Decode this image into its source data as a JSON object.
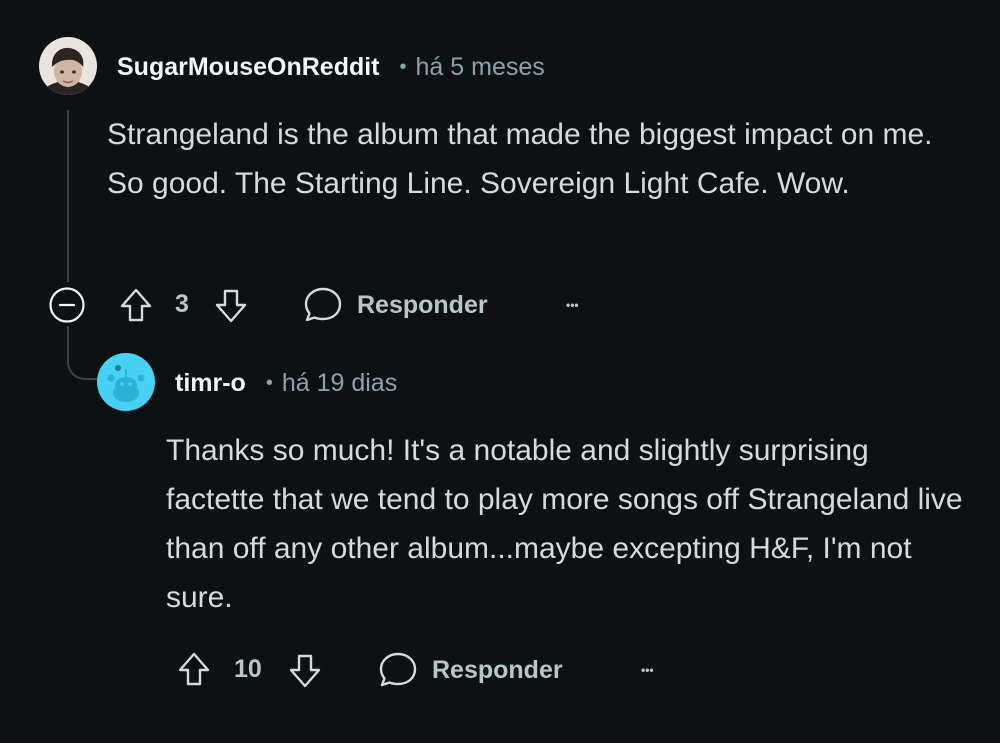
{
  "comments": [
    {
      "username": "SugarMouseOnReddit",
      "separator": "•",
      "timestamp": "há 5 meses",
      "text": "Strangeland is the album that made the biggest impact on me. So good. The Starting Line. Sovereign Light Cafe. Wow.",
      "votes": "3",
      "reply_label": "Responder",
      "more_label": "•••",
      "avatar_icon": "user-photo-avatar",
      "collapse_icon": "collapse-minus-icon"
    },
    {
      "username": "timr-o",
      "separator": "•",
      "timestamp": "há 19 dias",
      "text": "Thanks so much! It's a notable and slightly surprising factette that we tend to play more songs off Strangeland live than off any other album...maybe excepting H&F, I'm not sure.",
      "votes": "10",
      "reply_label": "Responder",
      "more_label": "•••",
      "avatar_icon": "snoo-avatar",
      "avatar_color": "#46d1f5"
    }
  ],
  "colors": {
    "background": "#0e1113",
    "text": "#d7dadc",
    "muted": "#8ba2ad",
    "thread_line": "#3c4245"
  }
}
